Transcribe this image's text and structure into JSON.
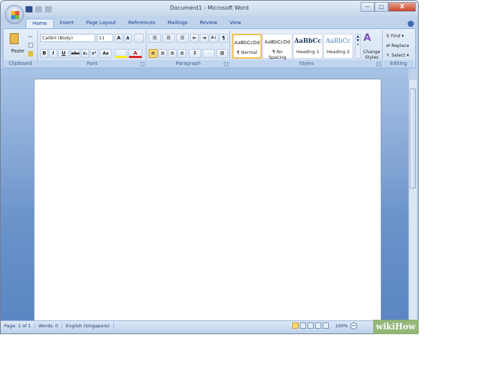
{
  "window": {
    "title": "Document1 - Microsoft Word",
    "minimize": "—",
    "maximize": "□",
    "close": "X"
  },
  "tabs": [
    "Home",
    "Insert",
    "Page Layout",
    "References",
    "Mailings",
    "Review",
    "View"
  ],
  "clipboard": {
    "paste": "Paste",
    "label": "Clipboard"
  },
  "font": {
    "name": "Calibri (Body)",
    "size": "11",
    "label": "Font",
    "bold": "B",
    "italic": "I",
    "underline": "U",
    "strike": "abc",
    "sub": "x₂",
    "sup": "x²",
    "case": "Aa",
    "grow": "A",
    "shrink": "A",
    "color": "A"
  },
  "paragraph": {
    "label": "Paragraph",
    "sort": "A↓",
    "pilcrow": "¶"
  },
  "styles": {
    "label": "Styles",
    "items": [
      {
        "preview": "AaBbCcDd",
        "name": "¶ Normal"
      },
      {
        "preview": "AaBbCcDd",
        "name": "¶ No Spacing"
      },
      {
        "preview": "AaBbCc",
        "name": "Heading 1"
      },
      {
        "preview": "AaBbCc",
        "name": "Heading 2"
      }
    ],
    "change": "Change Styles"
  },
  "editing": {
    "label": "Editing",
    "find": "Find",
    "replace": "Replace",
    "select": "Select"
  },
  "status": {
    "page": "Page: 1 of 1",
    "words": "Words: 0",
    "language": "English (Singapore)",
    "zoom": "100%"
  },
  "watermark": "wikiHow"
}
